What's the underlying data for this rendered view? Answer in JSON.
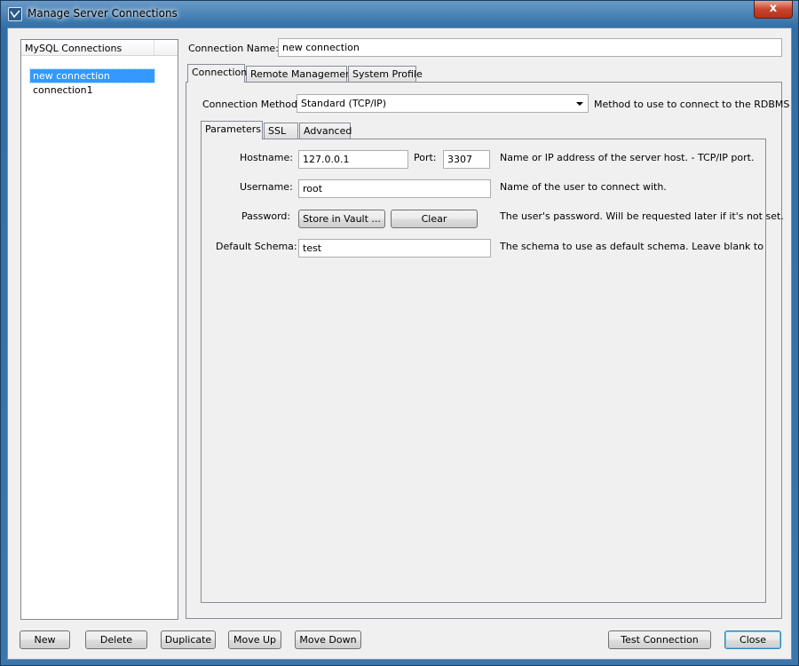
{
  "window": {
    "title": "Manage Server Connections",
    "close_glyph": "x"
  },
  "sidebar": {
    "header": "MySQL Connections",
    "items": [
      {
        "label": "new connection",
        "selected": true
      },
      {
        "label": "connection1",
        "selected": false
      }
    ]
  },
  "connection_name": {
    "label": "Connection Name:",
    "value": "new connection"
  },
  "main_tabs": [
    {
      "label": "Connection",
      "active": true
    },
    {
      "label": "Remote Management",
      "active": false
    },
    {
      "label": "System Profile",
      "active": false
    }
  ],
  "connection_method": {
    "label": "Connection Method:",
    "value": "Standard (TCP/IP)",
    "help": "Method to use to connect to the RDBMS"
  },
  "sub_tabs": [
    {
      "label": "Parameters",
      "active": true
    },
    {
      "label": "SSL",
      "active": false
    },
    {
      "label": "Advanced",
      "active": false
    }
  ],
  "parameters": {
    "hostname": {
      "label": "Hostname:",
      "value": "127.0.0.1"
    },
    "port": {
      "label": "Port:",
      "value": "3307"
    },
    "hostname_help": "Name or IP address of the server host. - TCP/IP port.",
    "username": {
      "label": "Username:",
      "value": "root",
      "help": "Name of the user to connect with."
    },
    "password": {
      "label": "Password:",
      "store_button": "Store in Vault ...",
      "clear_button": "Clear",
      "help": "The user's password. Will be requested later if it's not set."
    },
    "default_schema": {
      "label": "Default Schema:",
      "value": "test",
      "help": "The schema to use as default schema. Leave blank to select it"
    }
  },
  "footer": {
    "new": "New",
    "delete": "Delete",
    "duplicate": "Duplicate",
    "move_up": "Move Up",
    "move_down": "Move Down",
    "test_connection": "Test Connection",
    "close": "Close"
  },
  "colors": {
    "selection": "#3399ff",
    "title_bar": "#3b77ad",
    "close_button": "#c7452c"
  }
}
